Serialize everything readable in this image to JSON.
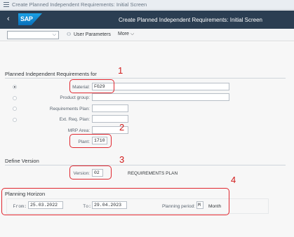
{
  "window": {
    "title": "Create Planned Independent Requirements: Initial Screen"
  },
  "shell": {
    "logo_text": "SAP",
    "title": "Create Planned Independent Requirements: Initial Screen",
    "back_glyph": "‹"
  },
  "toolbar": {
    "dropdown_value": "",
    "user_parameters_label": "User Parameters",
    "more_label": "More",
    "more_chevron": "⌵"
  },
  "pir_section": {
    "title": "Planned Independent Requirements for",
    "selected_radio": "material",
    "material": {
      "label": "Material:",
      "value": "FG29"
    },
    "product_group": {
      "label": "Product group:",
      "value": ""
    },
    "requirements_plan": {
      "label": "Requirements Plan:",
      "value": ""
    },
    "ext_req_plan": {
      "label": "Ext. Req. Plan:",
      "value": ""
    },
    "mrp_area": {
      "label": "MRP Area:",
      "value": ""
    },
    "plant": {
      "label": "Plant:",
      "value": "1710"
    }
  },
  "version_section": {
    "title": "Define Version",
    "version": {
      "label": "Version:",
      "value": "02",
      "description": "REQUIREMENTS PLAN"
    }
  },
  "horizon_section": {
    "title": "Planning Horizon",
    "from": {
      "label": "From:",
      "value": "25.03.2022"
    },
    "to": {
      "label": "To:",
      "value": "29.04.2023"
    },
    "period": {
      "label": "Planning period:",
      "value": "M",
      "unit": "Month"
    }
  },
  "annotations": {
    "n1": "1",
    "n2": "2",
    "n3": "3",
    "n4": "4",
    "color": "#e0272f"
  },
  "colors": {
    "shell": "#2b3e52",
    "logo_blue": "#0a6fb8",
    "background": "#f7f7f7"
  }
}
